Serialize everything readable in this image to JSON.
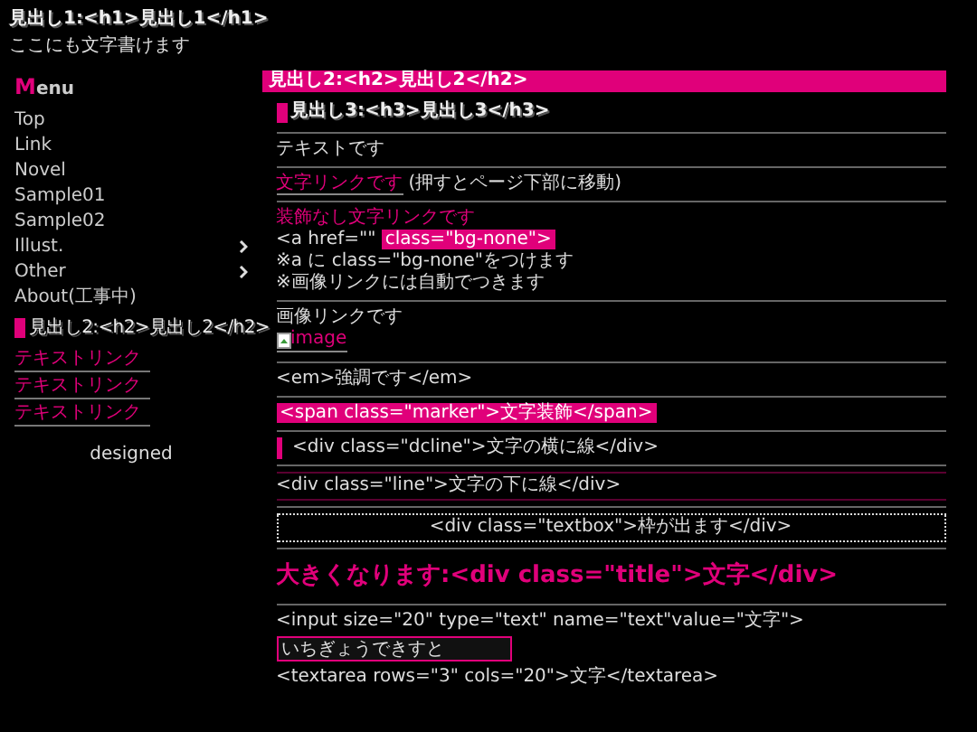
{
  "header": {
    "title": "見出し1:<h1>見出し1</h1>",
    "subtitle": "ここにも文字書けます"
  },
  "sidebar": {
    "menu_title": "Menu",
    "items": [
      {
        "label": "Top",
        "has_submenu": false
      },
      {
        "label": "Link",
        "has_submenu": false
      },
      {
        "label": "Novel",
        "has_submenu": false
      },
      {
        "label": "Sample01",
        "has_submenu": false
      },
      {
        "label": "Sample02",
        "has_submenu": false
      },
      {
        "label": "Illust.",
        "has_submenu": true
      },
      {
        "label": "Other",
        "has_submenu": true
      },
      {
        "label": "About(工事中)",
        "has_submenu": false
      }
    ],
    "heading": "見出し2:<h2>見出し2</h2>",
    "links": [
      "テキストリンク",
      "テキストリンク",
      "テキストリンク"
    ],
    "footer": "designed"
  },
  "main": {
    "heading": "見出し2:<h2>見出し2</h2>",
    "sections": [
      {
        "kind": "h3",
        "text": "見出し3:<h3>見出し3</h3>"
      },
      {
        "kind": "text",
        "text": "テキストです"
      },
      {
        "kind": "link",
        "link": "文字リンクです",
        "note": "(押すとページ下部に移動)"
      },
      {
        "kind": "bgnone",
        "title": "装飾なし文字リンクです",
        "code": "<a href=\"\"",
        "code_marker": "class=\"bg-none\">",
        "notes": [
          "※a に class=\"bg-none\"をつけます",
          "※画像リンクには自動でつきます"
        ]
      },
      {
        "kind": "image",
        "text": "画像リンクです",
        "alt": "image"
      },
      {
        "kind": "text",
        "text": "<em>強調です</em>"
      },
      {
        "kind": "marker",
        "text": "<span class=\"marker\">文字装飾</span>"
      },
      {
        "kind": "dcline",
        "text": "<div class=\"dcline\">文字の横に線</div>"
      },
      {
        "kind": "line",
        "text": "<div class=\"line\">文字の下に線</div>"
      },
      {
        "kind": "textbox",
        "text": "<div class=\"textbox\">枠が出ます</div>"
      },
      {
        "kind": "title",
        "text": "大きくなります:<div class=\"title\">文字</div>"
      },
      {
        "kind": "form",
        "code": "<input size=\"20\" type=\"text\" name=\"text\"value=\"文字\">",
        "value": "いちぎょうできすと",
        "code2": "<textarea rows=\"3\" cols=\"20\">文字</textarea>"
      }
    ]
  }
}
